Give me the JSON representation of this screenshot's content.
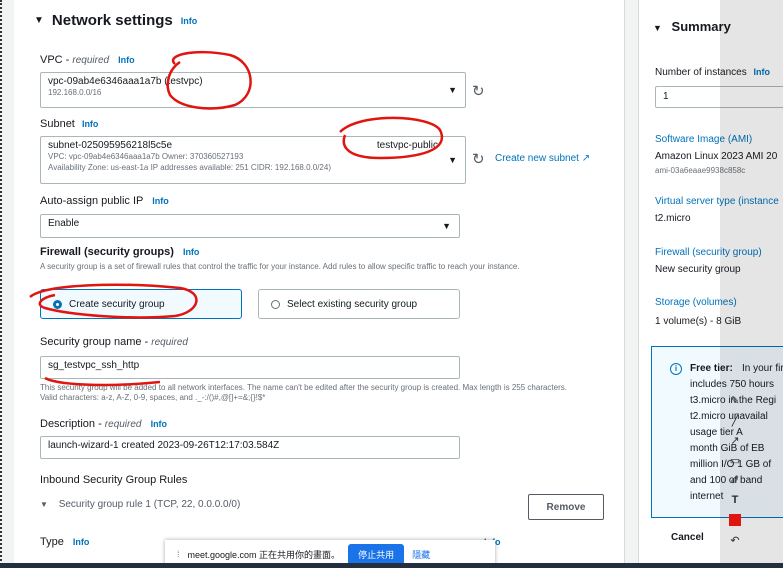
{
  "network": {
    "title": "Network settings",
    "info": "Info",
    "vpc_label": "VPC - ",
    "vpc_required": "required",
    "vpc_value": "vpc-09ab4e6346aaa1a7b (testvpc)",
    "vpc_cidr": "192.168.0.0/16",
    "subnet_label": "Subnet",
    "subnet_value": "subnet-025095956218l5c5e",
    "subnet_name": "testvpc-public",
    "subnet_detail1": "VPC: vpc-09ab4e6346aaa1a7b    Owner: 370360527193",
    "subnet_detail2": "Availability Zone: us-east-1a    IP addresses available: 251    CIDR: 192.168.0.0/24)",
    "create_subnet": "Create new subnet",
    "auto_ip_label": "Auto-assign public IP",
    "auto_ip_value": "Enable",
    "firewall_label": "Firewall (security groups)",
    "firewall_desc": "A security group is a set of firewall rules that control the traffic for your instance. Add rules to allow specific traffic to reach your instance.",
    "create_sg": "Create security group",
    "select_sg": "Select existing security group",
    "sg_name_label": "Security group name - ",
    "sg_name_value": "sg_testvpc_ssh_http",
    "sg_name_desc": "This security group will be added to all network interfaces. The name can't be edited after the security group is created. Max length is 255 characters. Valid characters: a-z, A-Z, 0-9, spaces, and ._-:/()#,@[]+=&;{}!$*",
    "desc_label": "Description - ",
    "desc_value": "launch-wizard-1 created 2023-09-26T12:17:03.584Z",
    "inbound_label": "Inbound Security Group Rules",
    "rule1": "Security group rule 1 (TCP, 22, 0.0.0.0/0)",
    "remove": "Remove",
    "type_label": "Type"
  },
  "summary": {
    "title": "Summary",
    "instances_label": "Number of instances",
    "instances_value": "1",
    "ami_label": "Software Image (AMI)",
    "ami_value": "Amazon Linux 2023 AMI 20",
    "ami_id": "ami-03a6eaae9938c858c",
    "vst_label": "Virtual server type (instance",
    "vst_value": "t2.micro",
    "fw_label": "Firewall (security group)",
    "fw_value": "New security group",
    "storage_label": "Storage (volumes)",
    "storage_value": "1 volume(s) - 8 GiB",
    "free_tier_title": "Free tier:",
    "free_tier_lines": [
      "In your fir",
      "includes 750 hours",
      "t3.micro in the Regi",
      "t2.micro unavailal",
      "usage tier A",
      "month GiB of EB",
      "million I/O 1 GB of",
      "and 100 of band",
      "internet"
    ],
    "cancel": "Cancel"
  },
  "share_bar": {
    "text": "meet.google.com 正在共用你的畫面。",
    "stop": "停止共用",
    "hide": "隱藏"
  },
  "colors": {
    "link": "#0073bb",
    "annotation": "#e0150f",
    "share_button": "#1a73e8"
  }
}
